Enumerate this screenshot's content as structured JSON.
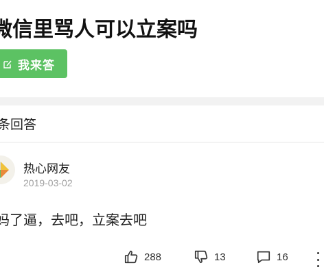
{
  "question": {
    "title": "微信里骂人可以立案吗"
  },
  "answer_button": {
    "label": "我来答",
    "icon": "edit-icon",
    "color": "#5cc263"
  },
  "answers_header": {
    "count_label": "条回答"
  },
  "answer": {
    "user_name": "热心网友",
    "date": "2019-03-02",
    "text": "妈了逼，去吧，立案去吧",
    "likes": "288",
    "dislikes": "13",
    "comments": "16"
  },
  "icons": {
    "like": "thumbs-up-icon",
    "dislike": "thumbs-down-icon",
    "comment": "comment-icon",
    "more": "more-vertical-icon"
  }
}
